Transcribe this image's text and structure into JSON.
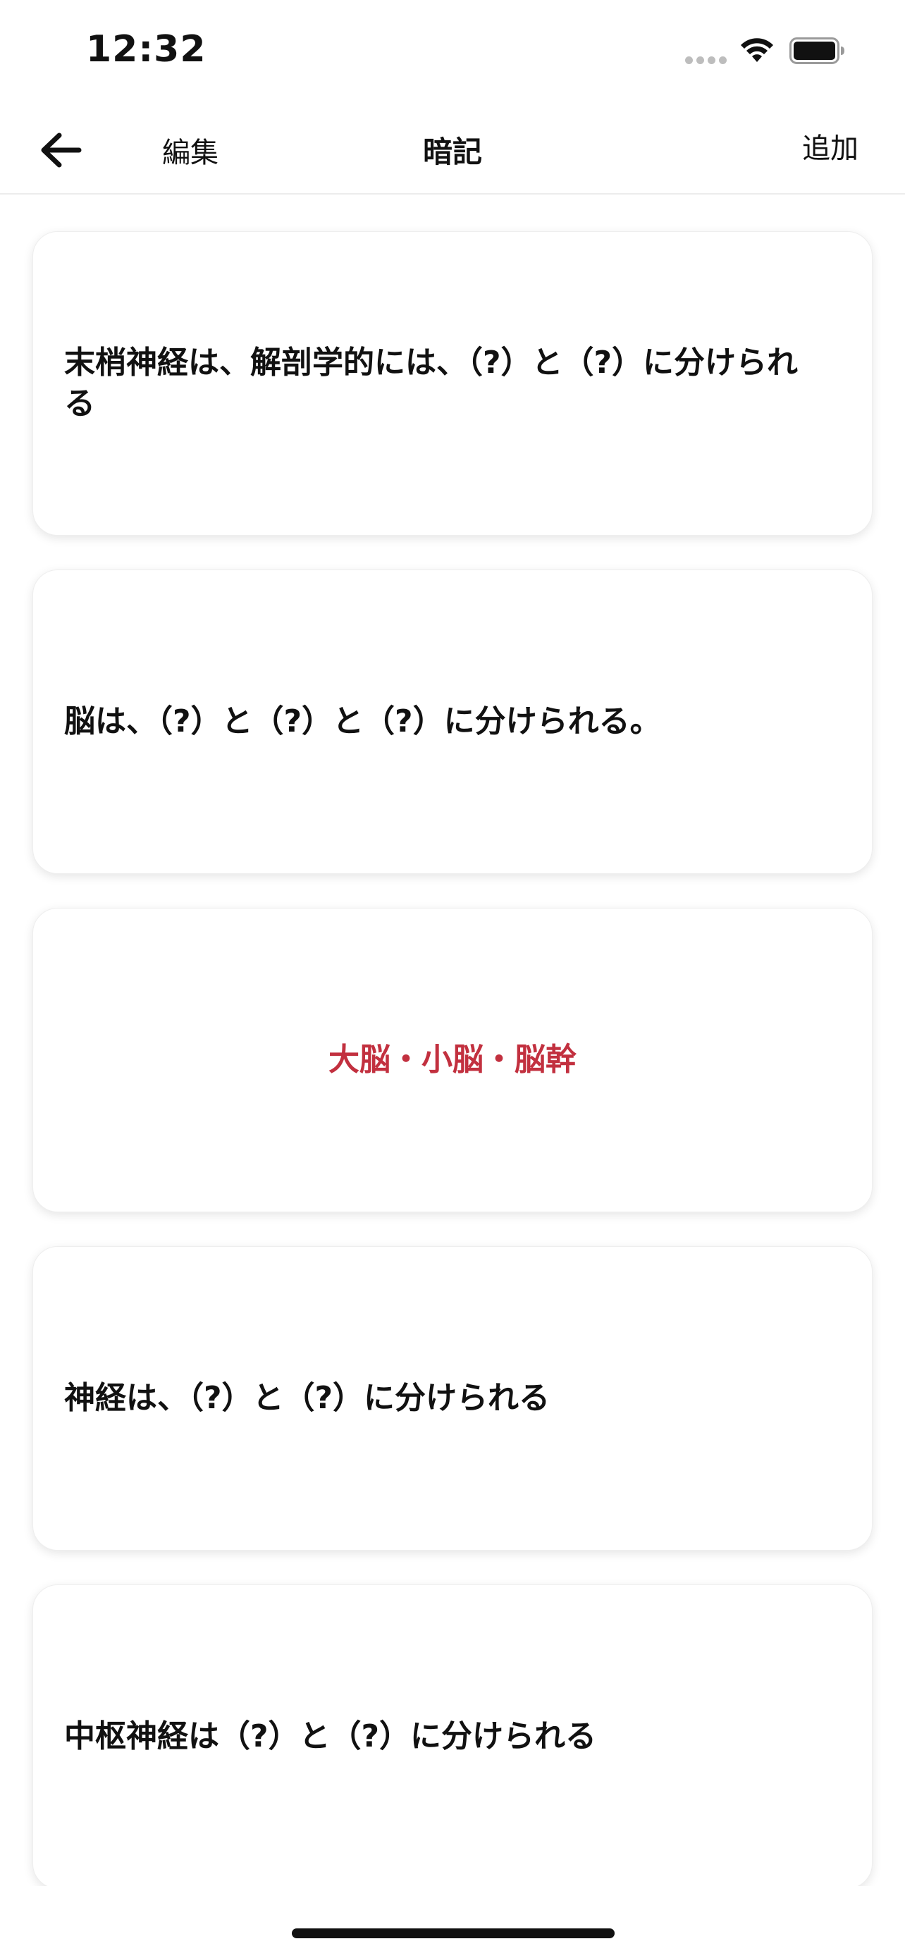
{
  "status_bar": {
    "time": "12:32"
  },
  "nav": {
    "back_icon": "arrow-left-icon",
    "edit_label": "編集",
    "title": "暗記",
    "add_label": "追加"
  },
  "cards": [
    {
      "text": "末梢神経は、解剖学的には、（?）と（?）に分けられる",
      "kind": "question"
    },
    {
      "text": "脳は、（?）と（?）と（?）に分けられる。",
      "kind": "question"
    },
    {
      "text": "大脳・小脳・脳幹",
      "kind": "answer"
    },
    {
      "text": "神経は、（?）と（?）に分けられる",
      "kind": "question"
    },
    {
      "text": "中枢神経は（?）と（?）に分けられる",
      "kind": "question"
    }
  ],
  "colors": {
    "answer_text": "#c2303f",
    "text": "#111111",
    "background": "#ffffff"
  }
}
